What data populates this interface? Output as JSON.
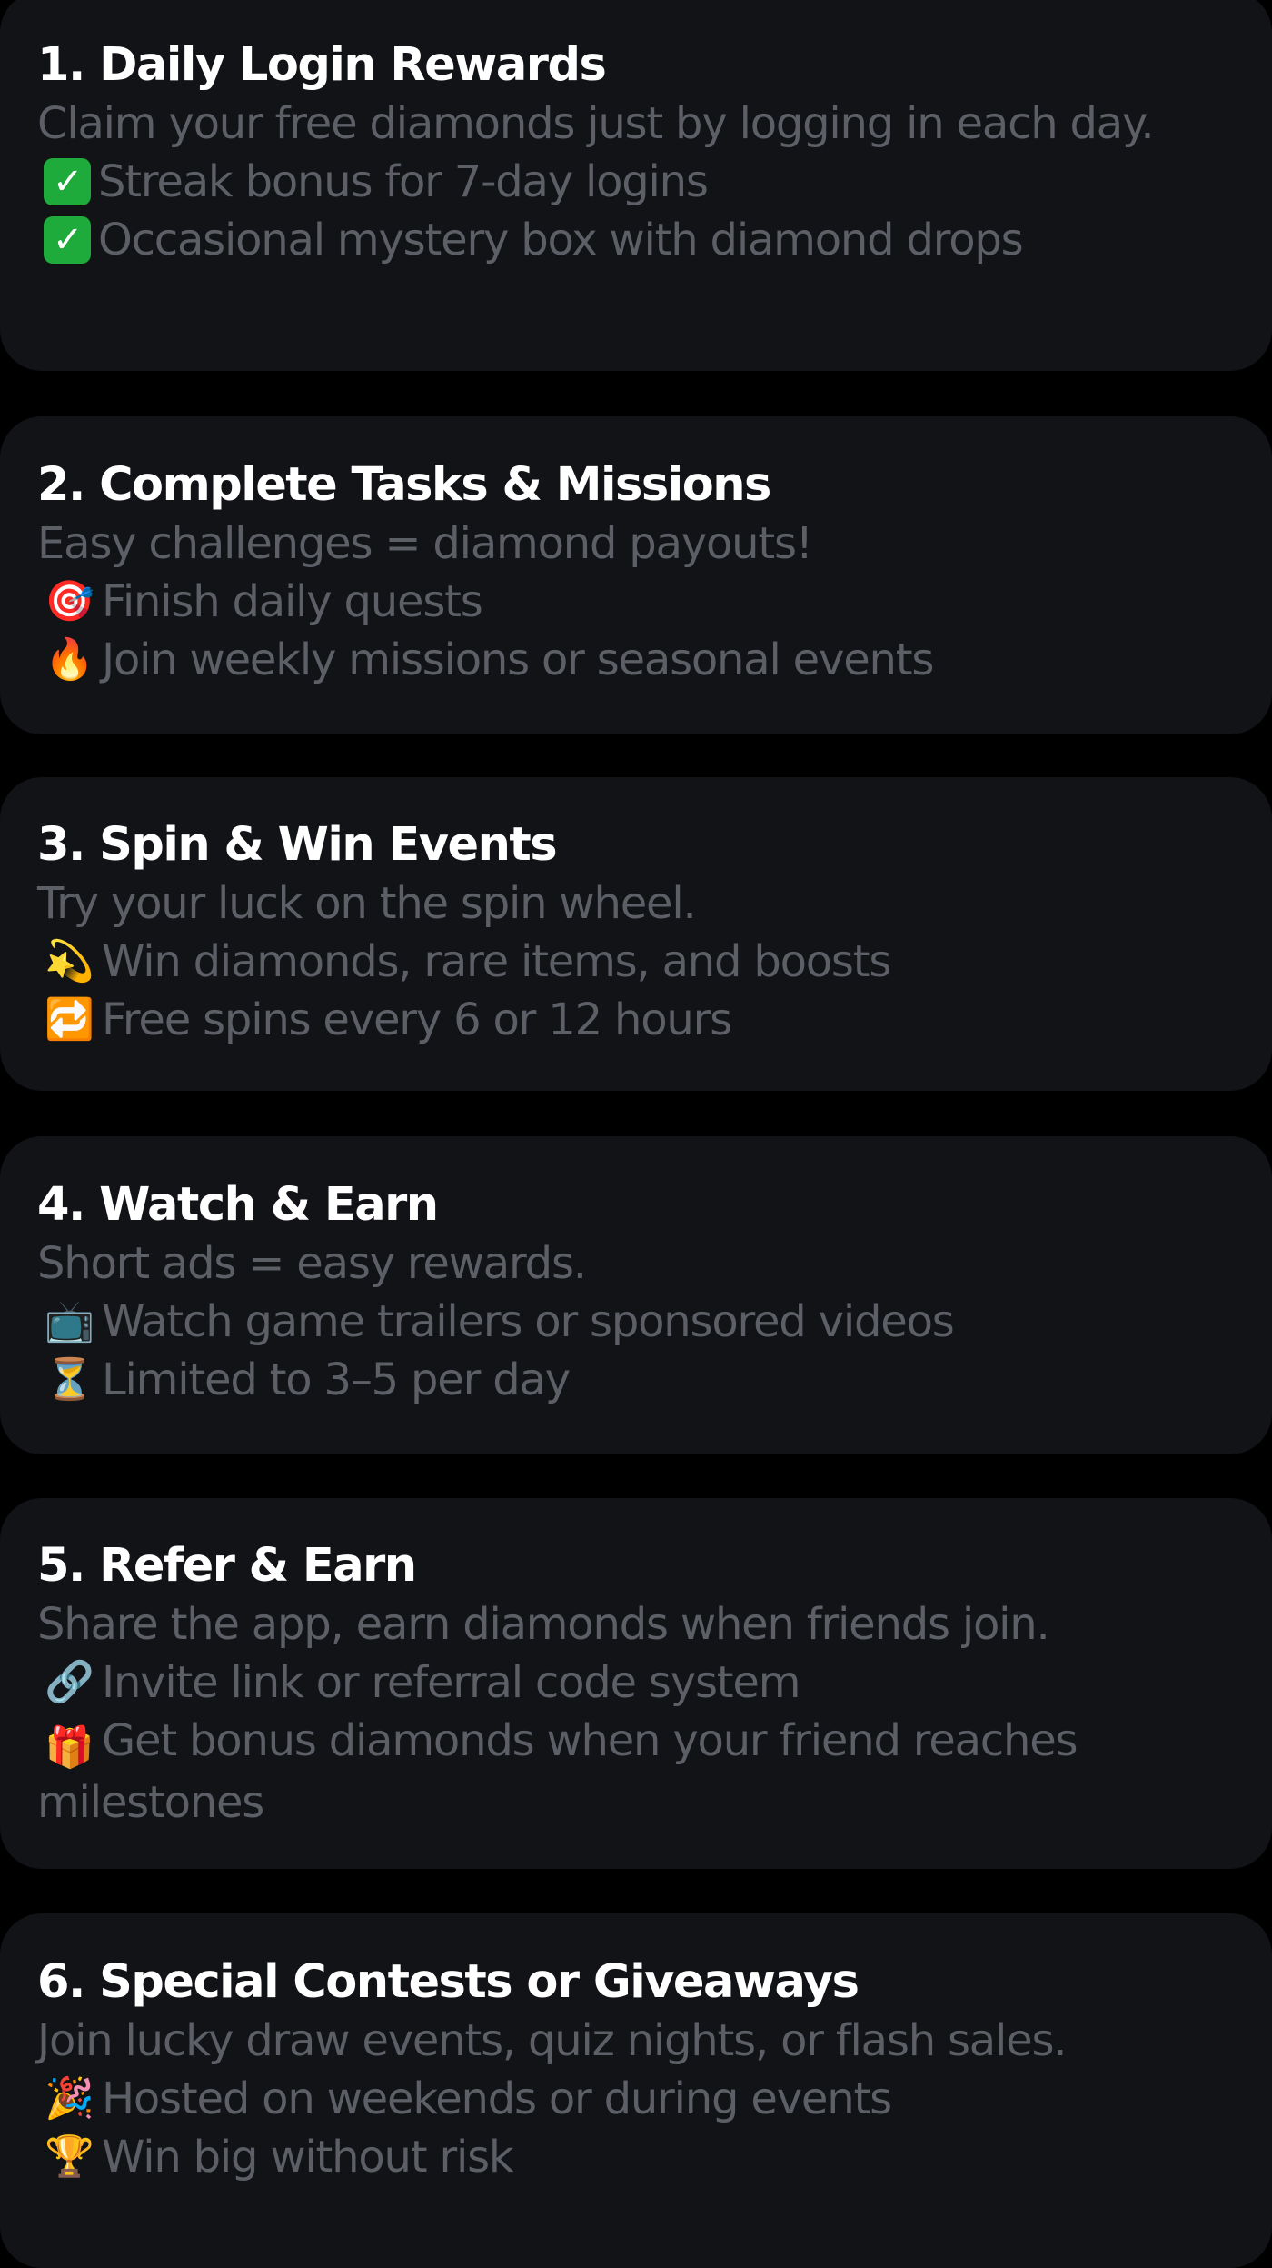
{
  "colors": {
    "page_background": "#000000",
    "card_background": "#111317",
    "title_text": "#ffffff",
    "body_text": "#5c5f66",
    "check_green": "#1faa3c"
  },
  "cards": [
    {
      "title": "1. Daily Login Rewards",
      "description": "Claim your free diamonds just by logging in each day.",
      "bullets": [
        {
          "icon": "✓",
          "icon_name": "check-mark-button-icon",
          "text": "Streak bonus for 7-day logins"
        },
        {
          "icon": "✓",
          "icon_name": "check-mark-button-icon",
          "text": "Occasional mystery box with diamond drops"
        }
      ]
    },
    {
      "title": "2. Complete Tasks & Missions",
      "description": "Easy challenges = diamond payouts!",
      "bullets": [
        {
          "icon": "🎯",
          "icon_name": "target-icon",
          "text": "Finish daily quests"
        },
        {
          "icon": "🔥",
          "icon_name": "fire-icon",
          "text": "Join weekly missions or seasonal events"
        }
      ]
    },
    {
      "title": "3. Spin & Win Events",
      "description": "Try your luck on the spin wheel.",
      "bullets": [
        {
          "icon": "💫",
          "icon_name": "dizzy-star-icon",
          "text": "Win diamonds, rare items, and boosts"
        },
        {
          "icon": "🔁",
          "icon_name": "repeat-icon",
          "text": "Free spins every 6 or 12 hours"
        }
      ]
    },
    {
      "title": "4. Watch & Earn",
      "description": "Short ads = easy rewards.",
      "bullets": [
        {
          "icon": "📺",
          "icon_name": "television-icon",
          "text": "Watch game trailers or sponsored videos"
        },
        {
          "icon": "⏳",
          "icon_name": "hourglass-icon",
          "text": "Limited to 3–5 per day"
        }
      ]
    },
    {
      "title": "5. Refer & Earn",
      "description": "Share the app, earn diamonds when friends join.",
      "bullets": [
        {
          "icon": "🔗",
          "icon_name": "link-icon",
          "text": "Invite link or referral code system"
        },
        {
          "icon": "🎁",
          "icon_name": "gift-icon",
          "text": "Get bonus diamonds when your friend reaches milestones"
        }
      ]
    },
    {
      "title": "6. Special Contests or Giveaways",
      "description": "Join lucky draw events, quiz nights, or flash sales.",
      "bullets": [
        {
          "icon": "🎉",
          "icon_name": "party-popper-icon",
          "text": "Hosted on weekends or during events"
        },
        {
          "icon": "🏆",
          "icon_name": "trophy-icon",
          "text": "Win big without risk"
        }
      ]
    }
  ]
}
